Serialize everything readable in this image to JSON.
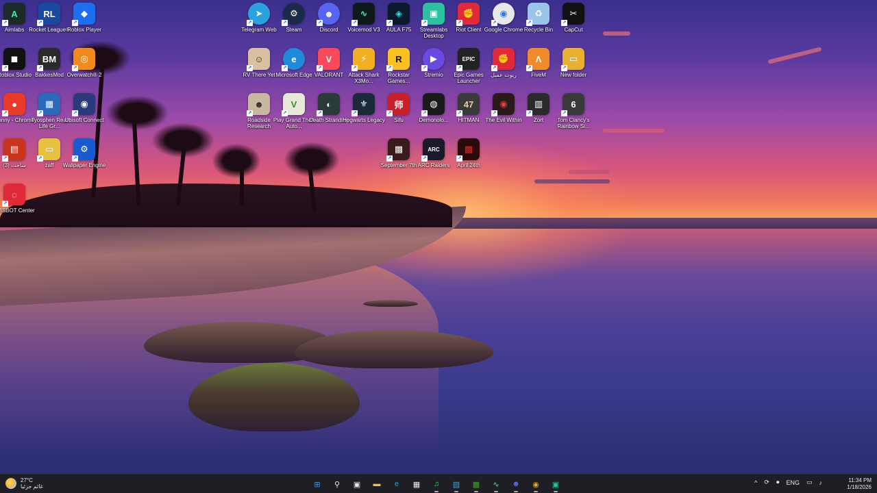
{
  "desktop": {
    "icons": [
      {
        "label": "Aimlabs",
        "glyph": "A",
        "color": "#1c2a2a",
        "fg": "#3ef0a0"
      },
      {
        "label": "Rocket League®",
        "glyph": "RL",
        "color": "#1a4aa0"
      },
      {
        "label": "Roblox Player",
        "glyph": "◆",
        "color": "#1e6ff0"
      },
      {
        "label": "Roblox Studio",
        "glyph": "◼",
        "color": "#111111"
      },
      {
        "label": "BakkesMod",
        "glyph": "BM",
        "color": "#2a2a2a"
      },
      {
        "label": "Overwatch® 2",
        "glyph": "◎",
        "color": "#f08a1c"
      },
      {
        "label": "Sonny - Chrome",
        "glyph": "●",
        "color": "#e83a2a"
      },
      {
        "label": "Tyosphen Real Life Gr...",
        "glyph": "▦",
        "color": "#2a6ab8"
      },
      {
        "label": "Ubisoft Connect",
        "glyph": "◉",
        "color": "#2a3a7a"
      },
      {
        "label": "ساخت (3)",
        "glyph": "▤",
        "color": "#c8341e"
      },
      {
        "label": "zaff",
        "glyph": "▭",
        "color": "#e8c040"
      },
      {
        "label": "Wallpaper Engine",
        "glyph": "⚙",
        "color": "#1a5ad0"
      },
      {
        "label": "OBSBOT Center",
        "glyph": "◌",
        "color": "#e02a3a"
      },
      {
        "label": "Telegram Web",
        "glyph": "➤",
        "color": "#2aa2e0",
        "round": true
      },
      {
        "label": "Steam",
        "glyph": "⚙",
        "color": "#1a2a4a",
        "round": true
      },
      {
        "label": "Discord",
        "glyph": "☻",
        "color": "#5865f2",
        "round": true
      },
      {
        "label": "Voicemod V3",
        "glyph": "∿",
        "color": "#0e1a1a",
        "fg": "#3ef0c0"
      },
      {
        "label": "AULA F75",
        "glyph": "◈",
        "color": "#0a1a2a",
        "fg": "#2ae0f0"
      },
      {
        "label": "Streamlabs Desktop",
        "glyph": "▣",
        "color": "#2ac0a0"
      },
      {
        "label": "Riot Client",
        "glyph": "✊",
        "color": "#e02a3a"
      },
      {
        "label": "Google Chrome",
        "glyph": "◉",
        "color": "#e8e8e8",
        "fg": "#2a7ae0",
        "round": true
      },
      {
        "label": "Recycle Bin",
        "glyph": "♻",
        "color": "#9ac4e8"
      },
      {
        "label": "CapCut",
        "glyph": "✂",
        "color": "#111111"
      },
      {
        "label": "RV There Yet",
        "glyph": "☺",
        "color": "#d8c0a0",
        "fg": "#3a2a1a"
      },
      {
        "label": "Microsoft Edge",
        "glyph": "e",
        "color": "#1e8ad8",
        "round": true
      },
      {
        "label": "VALORANT",
        "glyph": "V",
        "color": "#fa4a5a"
      },
      {
        "label": "Attack Shark X3Mo...",
        "glyph": "⚡",
        "color": "#f0b020"
      },
      {
        "label": "Rockstar Games...",
        "glyph": "R",
        "color": "#f8c020",
        "fg": "#111"
      },
      {
        "label": "Stremio",
        "glyph": "▶",
        "color": "#6a4ae0",
        "round": true
      },
      {
        "label": "Epic Games Launcher",
        "glyph": "EPIC",
        "color": "#222222"
      },
      {
        "label": "ريوت عميل",
        "glyph": "✊",
        "color": "#e02a3a"
      },
      {
        "label": "FiveM",
        "glyph": "Λ",
        "color": "#f08a2a"
      },
      {
        "label": "New folder",
        "glyph": "▭",
        "color": "#e8b030"
      },
      {
        "label": "Roadside Research",
        "glyph": "☻",
        "color": "#c8b8a0",
        "fg": "#2a2a2a"
      },
      {
        "label": "Play Grand Theft Auto...",
        "glyph": "V",
        "color": "#e8e8d8",
        "fg": "#3a8a2a"
      },
      {
        "label": "Death Stranding",
        "glyph": "◐",
        "color": "#2a3a3a"
      },
      {
        "label": "Hogwarts Legacy",
        "glyph": "⚜",
        "color": "#1a2a3a"
      },
      {
        "label": "Sifu",
        "glyph": "师",
        "color": "#c8202a"
      },
      {
        "label": "Demonolo...",
        "glyph": "◍",
        "color": "#1a1a1a"
      },
      {
        "label": "HITMAN",
        "glyph": "47",
        "color": "#3a3a3a",
        "fg": "#e8d0a0"
      },
      {
        "label": "The Evil Within",
        "glyph": "◉",
        "color": "#2a1a1a",
        "fg": "#e04040"
      },
      {
        "label": "Zort",
        "glyph": "▥",
        "color": "#2a2a2a"
      },
      {
        "label": "Tom Clancy's Rainbow Si...",
        "glyph": "6",
        "color": "#3a3a3a"
      },
      {
        "label": "September 7th",
        "glyph": "▩",
        "color": "#3a1a1a"
      },
      {
        "label": "ARC Raiders",
        "glyph": "ARC",
        "color": "#1a1a2a"
      },
      {
        "label": "April 24th",
        "glyph": "▩",
        "color": "#2a0a0a",
        "fg": "#e02a2a"
      }
    ]
  },
  "taskbar": {
    "weather": {
      "temp": "27°C",
      "condition": "غائم جزئيا"
    },
    "apps": [
      {
        "name": "start",
        "glyph": "⊞",
        "color": "#3a9af0"
      },
      {
        "name": "search",
        "glyph": "⚲",
        "color": "#e8e8e8"
      },
      {
        "name": "task-view",
        "glyph": "▣",
        "color": "#e8e8e8"
      },
      {
        "name": "file-explorer",
        "glyph": "▬",
        "color": "#f0c040"
      },
      {
        "name": "edge",
        "glyph": "e",
        "color": "#2a9ae0"
      },
      {
        "name": "store",
        "glyph": "▦",
        "color": "#e8e8e8"
      },
      {
        "name": "spotify",
        "glyph": "♫",
        "color": "#1ed760"
      },
      {
        "name": "snipping",
        "glyph": "▧",
        "color": "#3aa0e0"
      },
      {
        "name": "minecraft",
        "glyph": "▩",
        "color": "#3aa02a"
      },
      {
        "name": "voicemod",
        "glyph": "∿",
        "color": "#3ef0c0"
      },
      {
        "name": "discord",
        "glyph": "☻",
        "color": "#5865f2"
      },
      {
        "name": "chrome",
        "glyph": "◉",
        "color": "#e8a030"
      },
      {
        "name": "streamlabs",
        "glyph": "▣",
        "color": "#2ac0a0"
      }
    ],
    "tray": {
      "chevron": "^",
      "language": "ENG"
    },
    "clock": {
      "time": "11:34 PM",
      "date": "1/18/2026"
    }
  }
}
